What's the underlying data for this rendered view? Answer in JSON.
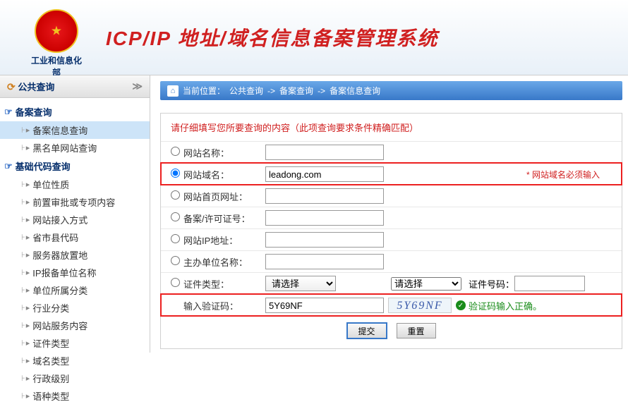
{
  "header": {
    "org": "工业和信息化部",
    "title": "ICP/IP 地址/域名信息备案管理系统"
  },
  "sidebar": {
    "section": "公共查询",
    "cat1": "备案查询",
    "cat2": "基础代码查询",
    "items1": [
      "备案信息查询",
      "黑名单网站查询"
    ],
    "items2": [
      "单位性质",
      "前置审批或专项内容",
      "网站接入方式",
      "省市县代码",
      "服务器放置地",
      "IP报备单位名称",
      "单位所属分类",
      "行业分类",
      "网站服务内容",
      "证件类型",
      "域名类型",
      "行政级别",
      "语种类型"
    ]
  },
  "breadcrumb": {
    "label": "当前位置：",
    "p1": "公共查询",
    "p2": "备案查询",
    "p3": "备案信息查询",
    "sep": "->"
  },
  "form": {
    "hint": "请仔细填写您所要查询的内容（此项查询要求条件精确匹配）",
    "rows": {
      "site_name": "网站名称：",
      "domain": "网站域名：",
      "homepage": "网站首页网址：",
      "license": "备案/许可证号：",
      "ip": "网站IP地址：",
      "sponsor": "主办单位名称：",
      "cert_type": "证件类型：",
      "captcha": "输入验证码："
    },
    "values": {
      "domain": "leadong.com",
      "captcha": "5Y69NF",
      "captcha_img": "5Y69NF"
    },
    "select_placeholder": "请选择",
    "cert_no_label": "证件号码：",
    "required_note": "* 网站域名必须输入",
    "captcha_ok": "验证码输入正确。",
    "submit": "提交",
    "reset": "重置"
  }
}
